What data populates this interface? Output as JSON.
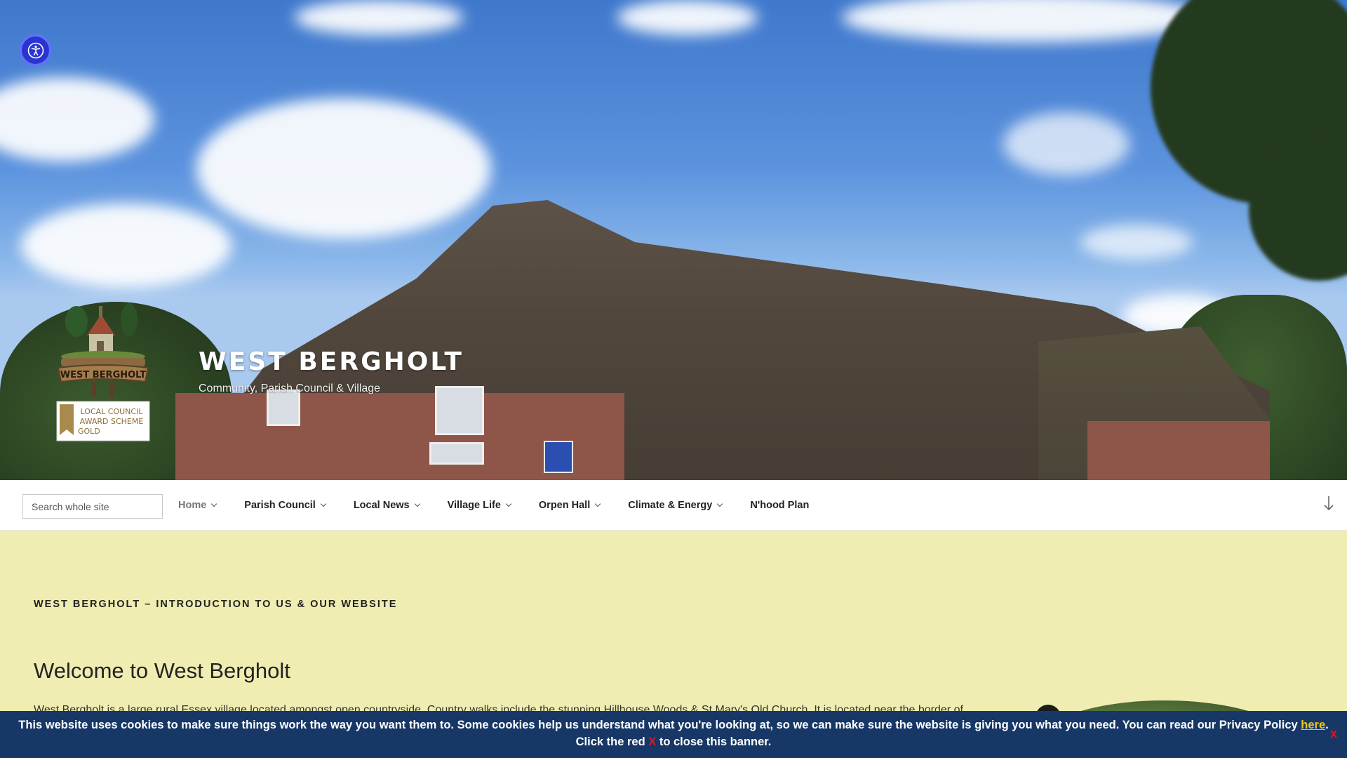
{
  "accessibility": {
    "icon": "accessibility-icon"
  },
  "site": {
    "title": "WEST BERGHOLT",
    "tagline": "Community, Parish Council & Village"
  },
  "logo": {
    "sign_text": "WEST BERGHOLT",
    "award_line1": "LOCAL COUNCIL",
    "award_line2": "AWARD SCHEME",
    "award_line3": "GOLD"
  },
  "search": {
    "placeholder": "Search whole site"
  },
  "nav": {
    "items": [
      {
        "label": "Home",
        "has_dropdown": true
      },
      {
        "label": "Parish Council",
        "has_dropdown": true
      },
      {
        "label": "Local News",
        "has_dropdown": true
      },
      {
        "label": "Village Life",
        "has_dropdown": true
      },
      {
        "label": "Orpen Hall",
        "has_dropdown": true
      },
      {
        "label": "Climate & Energy",
        "has_dropdown": true
      },
      {
        "label": "N'hood Plan",
        "has_dropdown": false
      }
    ],
    "scroll_icon": "arrow-down-icon"
  },
  "main": {
    "entry_title": "WEST BERGHOLT – INTRODUCTION TO US & OUR WEBSITE",
    "heading": "Welcome to West Bergholt",
    "intro_before": "West Bergholt is a large rural Essex village located amongst open countryside.  Country walks include the stunning ",
    "intro_link": "Hillhouse Woods & St Mary's Old Church",
    "intro_after": ".  It is located near the border of"
  },
  "cookie_banner": {
    "text_part1": "This website uses cookies to make sure things work the way you want them to. Some cookies help us understand what you're looking at, so we can make sure the website is giving you what you need. You can read our Privacy Policy ",
    "link_text": "here",
    "text_part2": ". Click the red ",
    "red_x": "X",
    "text_part3": " to close this banner.",
    "close_label": "x"
  },
  "colors": {
    "content_background": "#efedb1",
    "cookie_background": "#173866",
    "cookie_link": "#f0c419",
    "close_red": "#e1141c",
    "accessibility_blue": "#2a35d1"
  }
}
